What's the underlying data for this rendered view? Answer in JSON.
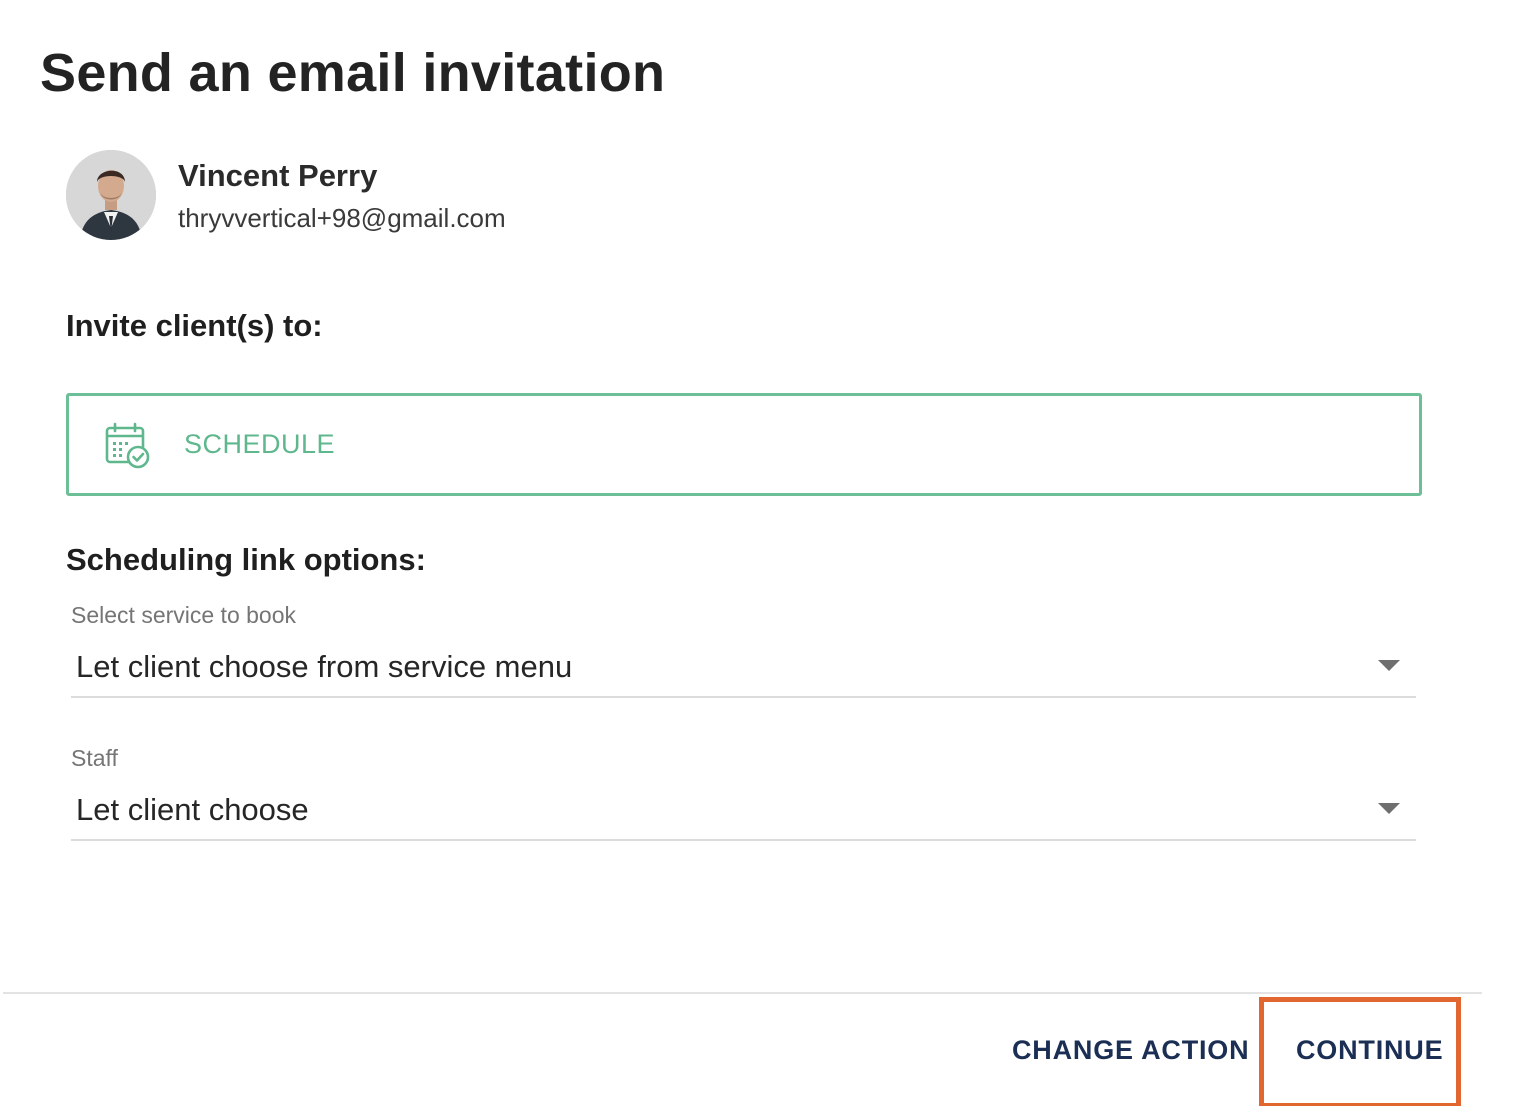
{
  "dialog": {
    "title": "Send an email invitation"
  },
  "contact": {
    "name": "Vincent Perry",
    "email": "thryvvertical+98@gmail.com",
    "avatar_icon": "person-photo"
  },
  "invite": {
    "heading": "Invite client(s) to:",
    "action": {
      "label": "SCHEDULE",
      "icon": "calendar-check-icon",
      "selected": true,
      "accent_color": "#5fb78d"
    }
  },
  "scheduling": {
    "heading": "Scheduling link options:",
    "service": {
      "label": "Select service to book",
      "value": "Let client choose from service menu"
    },
    "staff": {
      "label": "Staff",
      "value": "Let client choose"
    }
  },
  "footer": {
    "change_action_label": "CHANGE ACTION",
    "continue_label": "CONTINUE",
    "highlight_color": "#e2662f"
  }
}
